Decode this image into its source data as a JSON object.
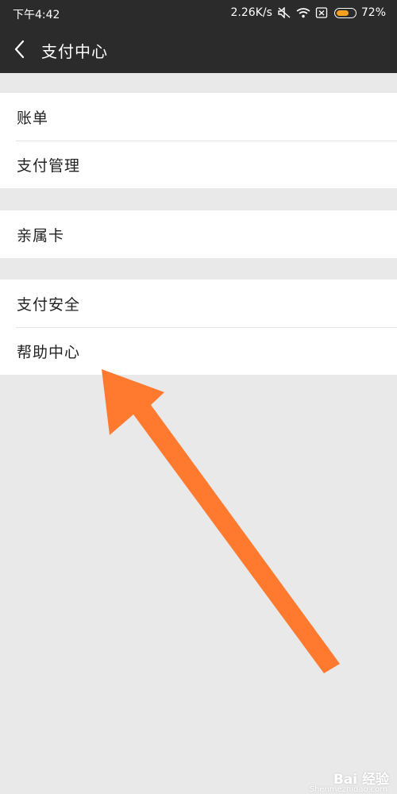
{
  "status_bar": {
    "time": "下午4:42",
    "network_speed": "2.26K/s",
    "battery_percent": "72%",
    "battery_level": 0.72,
    "icons": [
      "silent-icon",
      "wifi-icon",
      "sim-off-icon",
      "battery-icon"
    ]
  },
  "header": {
    "back_icon": "chevron-left-icon",
    "title": "支付中心"
  },
  "groups": [
    {
      "items": [
        {
          "label": "账单"
        },
        {
          "label": "支付管理"
        }
      ]
    },
    {
      "items": [
        {
          "label": "亲属卡"
        }
      ]
    },
    {
      "items": [
        {
          "label": "支付安全"
        },
        {
          "label": "帮助中心"
        }
      ]
    }
  ],
  "annotation": {
    "arrow_color": "#ff7a2f"
  },
  "colors": {
    "header_bg": "#2b2b2b",
    "page_bg": "#e9e9e9",
    "battery_fill": "#f3a11f"
  },
  "watermark": {
    "text": "Bai 经验",
    "url": "Shenmezhidao.com"
  }
}
